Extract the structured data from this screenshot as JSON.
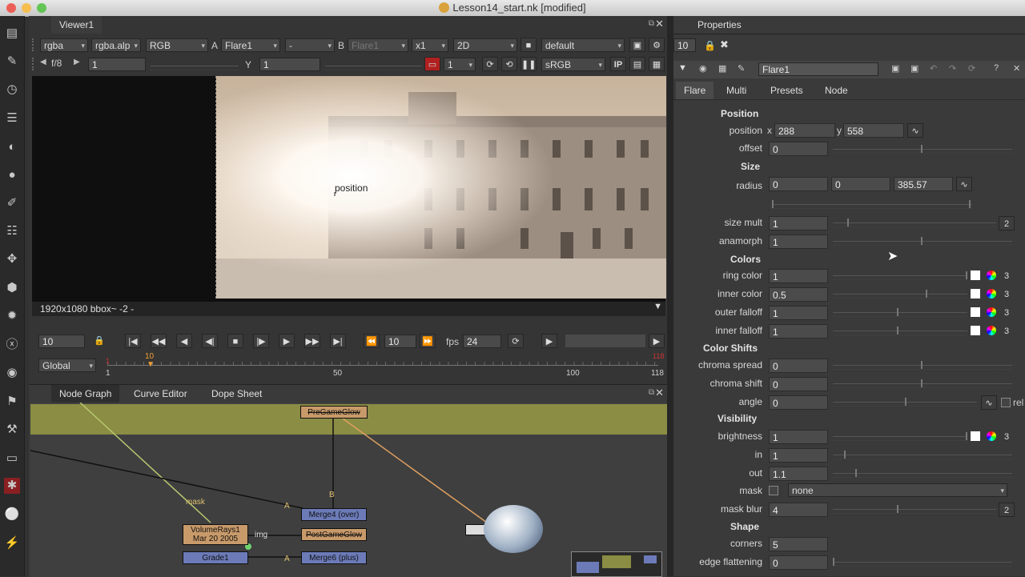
{
  "window": {
    "title": "Lesson14_start.nk [modified]"
  },
  "viewer": {
    "tab_label": "Viewer1",
    "channels": "rgba",
    "channel_alpha": "rgba.alp",
    "display_channels": "RGB",
    "a_label": "A",
    "a_input": "Flare1",
    "a_op": "-",
    "b_label": "B",
    "b_input": "Flare1",
    "zoom": "x1",
    "mode": "2D",
    "lut_preset": "default",
    "fstop": "f/8",
    "gain": "1",
    "y_label": "Y",
    "gamma": "1",
    "frame_skip": "1",
    "colorspace": "sRGB",
    "ip_label": "IP",
    "handle_label": "position",
    "format_info": "1920x1080 bbox~ -2 -"
  },
  "timeline": {
    "current_frame": "10",
    "step": "10",
    "fps_label": "fps",
    "fps": "24",
    "range_mode": "Global",
    "start_marker": "1",
    "current_marker": "10",
    "end_marker": "118",
    "ruler_labels": [
      "1",
      "50",
      "100",
      "118"
    ]
  },
  "graph": {
    "tabs": [
      "Node Graph",
      "Curve Editor",
      "Dope Sheet"
    ],
    "nodes": {
      "top": "PreGameGlow",
      "volume": "VolumeRays1",
      "volume_date": "Mar 20 2005",
      "merge4": "Merge4 (over)",
      "post": "PostGameGlow",
      "merge6": "Merge6 (plus)",
      "grade": "Grade1"
    },
    "edge_labels": {
      "mask": "mask",
      "img": "img",
      "a1": "A",
      "b": "B",
      "a2": "A"
    }
  },
  "properties": {
    "title": "Properties",
    "max_panels": "10",
    "node_name": "Flare1",
    "tabs": [
      "Flare",
      "Multi",
      "Presets",
      "Node"
    ],
    "sections": {
      "position": "Position",
      "size": "Size",
      "colors": "Colors",
      "color_shifts": "Color Shifts",
      "visibility": "Visibility",
      "shape": "Shape"
    },
    "position": {
      "label": "position",
      "x_label": "x",
      "x": "288",
      "y_label": "y",
      "y": "558"
    },
    "offset": {
      "label": "offset",
      "value": "0"
    },
    "radius": {
      "label": "radius",
      "v1": "0",
      "v2": "0",
      "v3": "385.57"
    },
    "size_mult": {
      "label": "size mult",
      "value": "1",
      "badge": "2"
    },
    "anamorph": {
      "label": "anamorph",
      "value": "1"
    },
    "ring_color": {
      "label": "ring color",
      "value": "1",
      "badge": "3"
    },
    "inner_color": {
      "label": "inner color",
      "value": "0.5",
      "badge": "3"
    },
    "outer_falloff": {
      "label": "outer falloff",
      "value": "1",
      "badge": "3"
    },
    "inner_falloff": {
      "label": "inner falloff",
      "value": "1",
      "badge": "3"
    },
    "chroma_spread": {
      "label": "chroma spread",
      "value": "0"
    },
    "chroma_shift": {
      "label": "chroma shift",
      "value": "0"
    },
    "angle": {
      "label": "angle",
      "value": "0",
      "extra": "rel"
    },
    "brightness": {
      "label": "brightness",
      "value": "1",
      "badge": "3"
    },
    "in": {
      "label": "in",
      "value": "1"
    },
    "out": {
      "label": "out",
      "value": "1.1"
    },
    "mask": {
      "label": "mask",
      "value": "none"
    },
    "mask_blur": {
      "label": "mask blur",
      "value": "4",
      "badge": "2"
    },
    "corners": {
      "label": "corners",
      "value": "5"
    },
    "edge_flattening": {
      "label": "edge flattening",
      "value": "0"
    }
  },
  "colors": {
    "accent_green": "#8a8d43",
    "node_orange": "#c89a6a",
    "node_blue": "#6c7bb8"
  }
}
